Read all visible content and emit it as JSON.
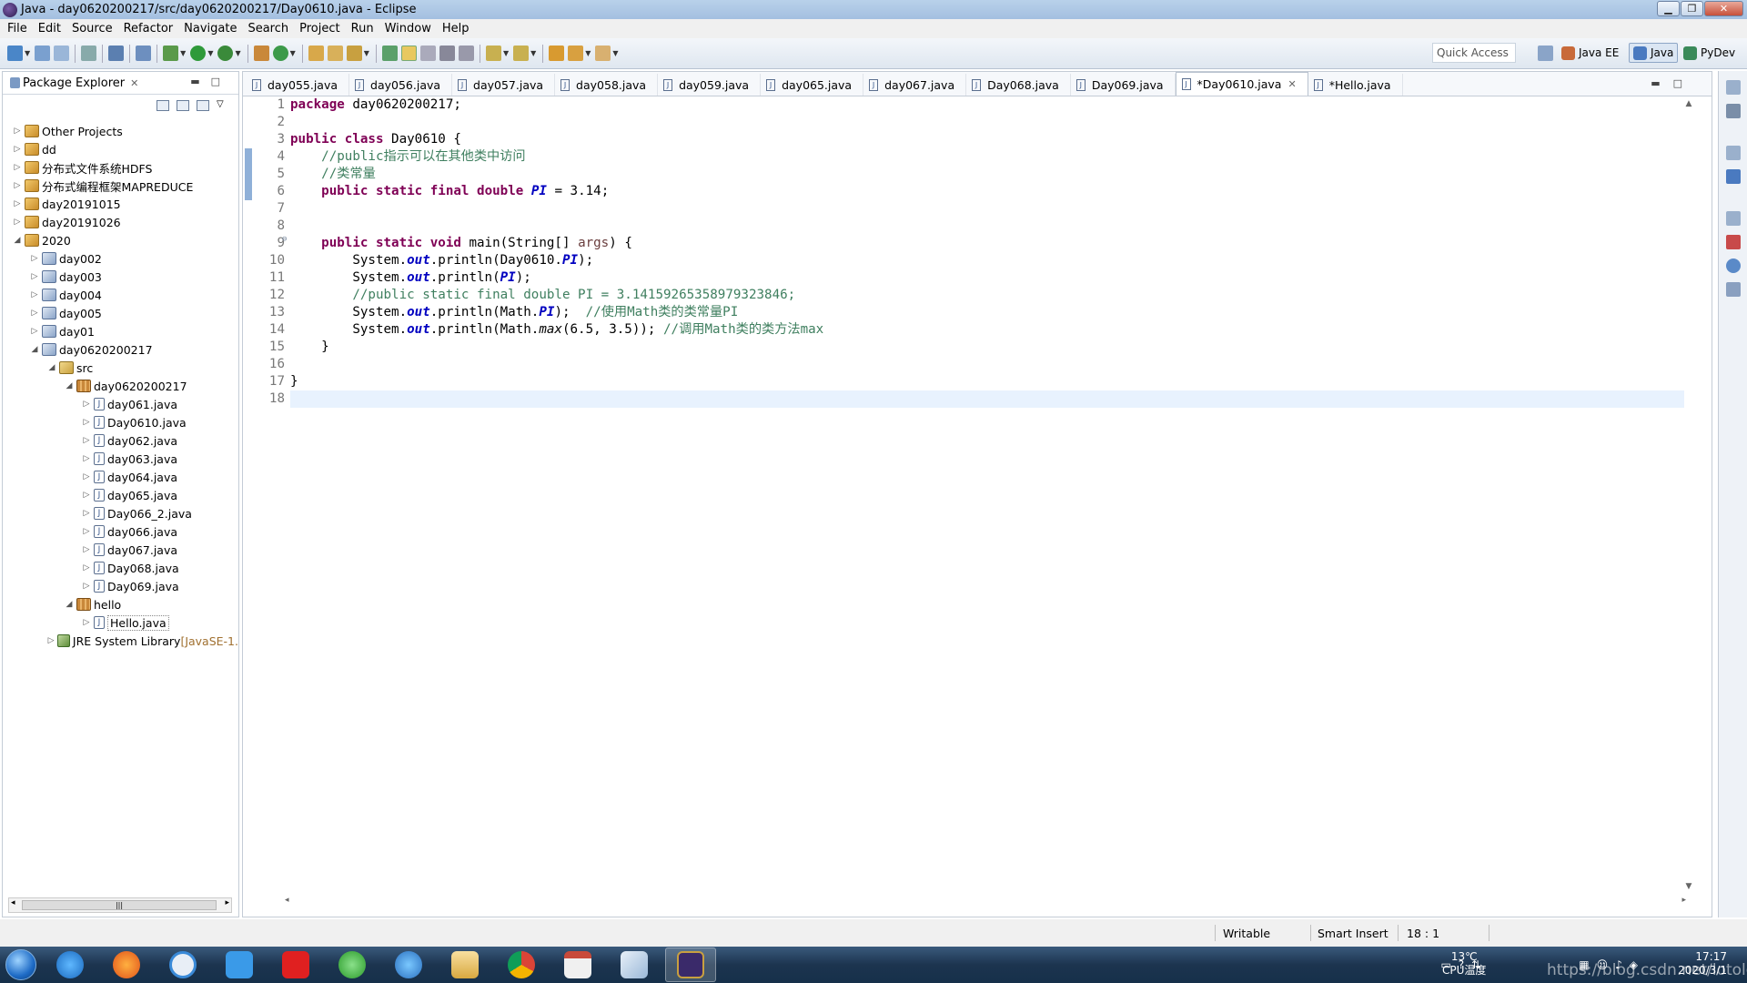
{
  "window": {
    "title": "Java - day0620200217/src/day0620200217/Day0610.java - Eclipse"
  },
  "menu": [
    "File",
    "Edit",
    "Source",
    "Refactor",
    "Navigate",
    "Search",
    "Project",
    "Run",
    "Window",
    "Help"
  ],
  "toolbar": {
    "quick_access": "Quick Access",
    "perspectives": [
      "Java EE",
      "Java",
      "PyDev"
    ]
  },
  "explorer": {
    "title": "Package Explorer",
    "tree": [
      {
        "label": "Other Projects",
        "depth": 0,
        "icon": "project-icon",
        "open": false
      },
      {
        "label": "dd",
        "depth": 0,
        "icon": "project-icon",
        "open": false
      },
      {
        "label": "分布式文件系统HDFS",
        "depth": 0,
        "icon": "project-icon",
        "open": false
      },
      {
        "label": "分布式编程框架MAPREDUCE",
        "depth": 0,
        "icon": "project-icon",
        "open": false
      },
      {
        "label": "day20191015",
        "depth": 0,
        "icon": "project-icon",
        "open": false
      },
      {
        "label": "day20191026",
        "depth": 0,
        "icon": "project-icon",
        "open": false
      },
      {
        "label": "2020",
        "depth": 0,
        "icon": "project-icon",
        "open": true
      },
      {
        "label": "day002",
        "depth": 1,
        "icon": "java-project-icon",
        "open": false
      },
      {
        "label": "day003",
        "depth": 1,
        "icon": "java-project-icon",
        "open": false
      },
      {
        "label": "day004",
        "depth": 1,
        "icon": "java-project-icon",
        "open": false
      },
      {
        "label": "day005",
        "depth": 1,
        "icon": "java-project-icon",
        "open": false
      },
      {
        "label": "day01",
        "depth": 1,
        "icon": "java-project-icon",
        "open": false
      },
      {
        "label": "day0620200217",
        "depth": 1,
        "icon": "java-project-icon",
        "open": true
      },
      {
        "label": "src",
        "depth": 2,
        "icon": "source-folder-icon",
        "open": true
      },
      {
        "label": "day0620200217",
        "depth": 3,
        "icon": "package-icon",
        "open": true
      },
      {
        "label": "day061.java",
        "depth": 4,
        "icon": "java-file-icon",
        "open": false
      },
      {
        "label": "Day0610.java",
        "depth": 4,
        "icon": "java-file-icon",
        "open": false
      },
      {
        "label": "day062.java",
        "depth": 4,
        "icon": "java-file-icon",
        "open": false
      },
      {
        "label": "day063.java",
        "depth": 4,
        "icon": "java-file-icon",
        "open": false
      },
      {
        "label": "day064.java",
        "depth": 4,
        "icon": "java-file-icon",
        "open": false
      },
      {
        "label": "day065.java",
        "depth": 4,
        "icon": "java-file-icon",
        "open": false
      },
      {
        "label": "Day066_2.java",
        "depth": 4,
        "icon": "java-file-icon",
        "open": false
      },
      {
        "label": "day066.java",
        "depth": 4,
        "icon": "java-file-icon",
        "open": false
      },
      {
        "label": "day067.java",
        "depth": 4,
        "icon": "java-file-icon",
        "open": false
      },
      {
        "label": "Day068.java",
        "depth": 4,
        "icon": "java-file-icon",
        "open": false
      },
      {
        "label": "Day069.java",
        "depth": 4,
        "icon": "java-file-icon",
        "open": false
      },
      {
        "label": "hello",
        "depth": 3,
        "icon": "package-icon",
        "open": true
      },
      {
        "label": "Hello.java",
        "depth": 4,
        "icon": "java-file-icon",
        "open": false
      },
      {
        "label": "JRE System Library",
        "suffix": "[JavaSE-1.",
        "depth": 2,
        "icon": "library-icon",
        "open": false
      }
    ]
  },
  "editor": {
    "tabs": [
      "day055.java",
      "day056.java",
      "day057.java",
      "day058.java",
      "day059.java",
      "day065.java",
      "day067.java",
      "Day068.java",
      "Day069.java",
      "*Day0610.java",
      "*Hello.java"
    ],
    "active_tab": 9,
    "current_line": 18
  },
  "status": {
    "writable": "Writable",
    "insert_mode": "Smart Insert",
    "position": "18 : 1"
  },
  "taskbar": {
    "temperature": "13℃",
    "cpu_label": "CPU温度",
    "time": "17:17",
    "date": "2020/3/1",
    "watermark": "https://blog.csdn.net/lotolgko"
  }
}
